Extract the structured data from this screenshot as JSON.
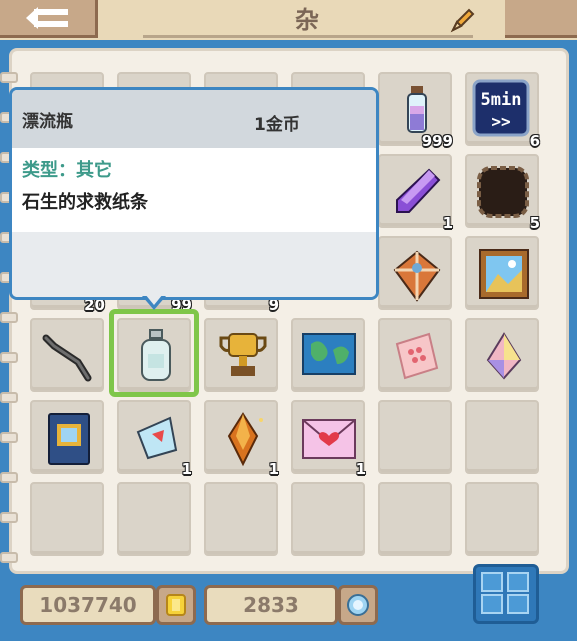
{
  "header": {
    "title": "杂",
    "back_icon": "back-arrow-icon",
    "edit_icon": "pencil-icon"
  },
  "tooltip": {
    "name": "漂流瓶",
    "price": "1金币",
    "type": "类型：其它",
    "description": "石生的求救纸条"
  },
  "slots": [
    {
      "row": 0,
      "col": 0,
      "icon": "",
      "qty": ""
    },
    {
      "row": 0,
      "col": 1,
      "icon": "",
      "qty": ""
    },
    {
      "row": 0,
      "col": 2,
      "icon": "",
      "qty": ""
    },
    {
      "row": 0,
      "col": 3,
      "icon": "",
      "qty": ""
    },
    {
      "row": 0,
      "col": 4,
      "icon": "potion-vial-icon",
      "qty": "999"
    },
    {
      "row": 0,
      "col": 5,
      "icon": "speedup-5min-icon",
      "qty": "6"
    },
    {
      "row": 1,
      "col": 4,
      "icon": "purple-crystal-icon",
      "qty": "1"
    },
    {
      "row": 1,
      "col": 5,
      "icon": "dark-hole-icon",
      "qty": "5"
    },
    {
      "row": 2,
      "col": 0,
      "icon": "",
      "qty": "20"
    },
    {
      "row": 2,
      "col": 1,
      "icon": "",
      "qty": "99"
    },
    {
      "row": 2,
      "col": 2,
      "icon": "",
      "qty": "9"
    },
    {
      "row": 2,
      "col": 4,
      "icon": "kite-icon",
      "qty": ""
    },
    {
      "row": 2,
      "col": 5,
      "icon": "landscape-painting-icon",
      "qty": ""
    },
    {
      "row": 3,
      "col": 0,
      "icon": "bent-stick-icon",
      "qty": ""
    },
    {
      "row": 3,
      "col": 1,
      "icon": "drift-bottle-icon",
      "qty": ""
    },
    {
      "row": 3,
      "col": 2,
      "icon": "gold-trophy-icon",
      "qty": ""
    },
    {
      "row": 3,
      "col": 3,
      "icon": "world-map-icon",
      "qty": ""
    },
    {
      "row": 3,
      "col": 4,
      "icon": "pink-candy-pack-icon",
      "qty": ""
    },
    {
      "row": 3,
      "col": 5,
      "icon": "rainbow-gem-icon",
      "qty": ""
    },
    {
      "row": 4,
      "col": 0,
      "icon": "blue-book-icon",
      "qty": ""
    },
    {
      "row": 4,
      "col": 1,
      "icon": "ice-shard-icon",
      "qty": "1"
    },
    {
      "row": 4,
      "col": 2,
      "icon": "amber-crystal-icon",
      "qty": "1"
    },
    {
      "row": 4,
      "col": 3,
      "icon": "love-letter-icon",
      "qty": "1"
    },
    {
      "row": 4,
      "col": 4,
      "icon": "",
      "qty": ""
    },
    {
      "row": 4,
      "col": 5,
      "icon": "",
      "qty": ""
    },
    {
      "row": 5,
      "col": 0,
      "icon": "",
      "qty": ""
    },
    {
      "row": 5,
      "col": 1,
      "icon": "",
      "qty": ""
    },
    {
      "row": 5,
      "col": 2,
      "icon": "",
      "qty": ""
    },
    {
      "row": 5,
      "col": 3,
      "icon": "",
      "qty": ""
    },
    {
      "row": 5,
      "col": 4,
      "icon": "",
      "qty": ""
    },
    {
      "row": 5,
      "col": 5,
      "icon": "",
      "qty": ""
    }
  ],
  "speedup_label": "5min",
  "currency": {
    "gold": "1037740",
    "gold_icon": "gold-coin-icon",
    "gems": "2833",
    "gem_icon": "diamond-icon"
  },
  "view_toggle_icon": "grid-view-icon"
}
